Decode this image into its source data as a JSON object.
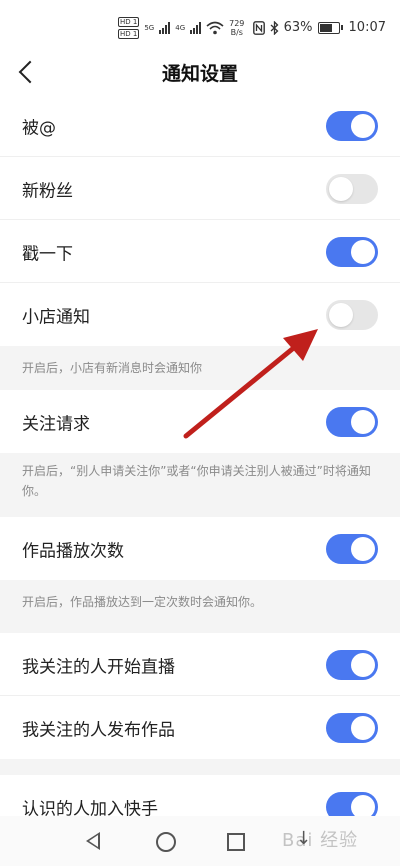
{
  "status_bar": {
    "hd1": "HD 1",
    "hd2": "HD 1",
    "net1": "5G",
    "net2": "4G",
    "speed_value": "729",
    "speed_unit": "B/s",
    "battery_percent": "63%",
    "battery_level": 0.63,
    "time": "10:07"
  },
  "header": {
    "title": "通知设置"
  },
  "settings": {
    "mention": {
      "label": "被@",
      "on": true
    },
    "new_fans": {
      "label": "新粉丝",
      "on": false
    },
    "poke": {
      "label": "戳一下",
      "on": true
    },
    "shop": {
      "label": "小店通知",
      "on": false,
      "note": "开启后，小店有新消息时会通知你"
    },
    "follow_request": {
      "label": "关注请求",
      "on": true,
      "note": "开启后，“别人申请关注你”或者“你申请关注别人被通过”时将通知你。"
    },
    "play_count": {
      "label": "作品播放次数",
      "on": true,
      "note": "开启后，作品播放达到一定次数时会通知你。"
    },
    "followed_live": {
      "label": "我关注的人开始直播",
      "on": true
    },
    "followed_post": {
      "label": "我关注的人发布作品",
      "on": true
    },
    "acquaintance": {
      "label": "认识的人加入快手",
      "on": true
    }
  },
  "watermark": "Bai 经验",
  "colors": {
    "toggle_on": "#4a78f0",
    "toggle_off": "#e6e6e6",
    "annotation_arrow": "#c0201c"
  },
  "icons": {
    "back": "chevron-left-icon",
    "nav_back": "triangle-back-icon",
    "nav_home": "circle-home-icon",
    "nav_recent": "square-recent-icon",
    "nav_down": "arrow-down-icon"
  }
}
